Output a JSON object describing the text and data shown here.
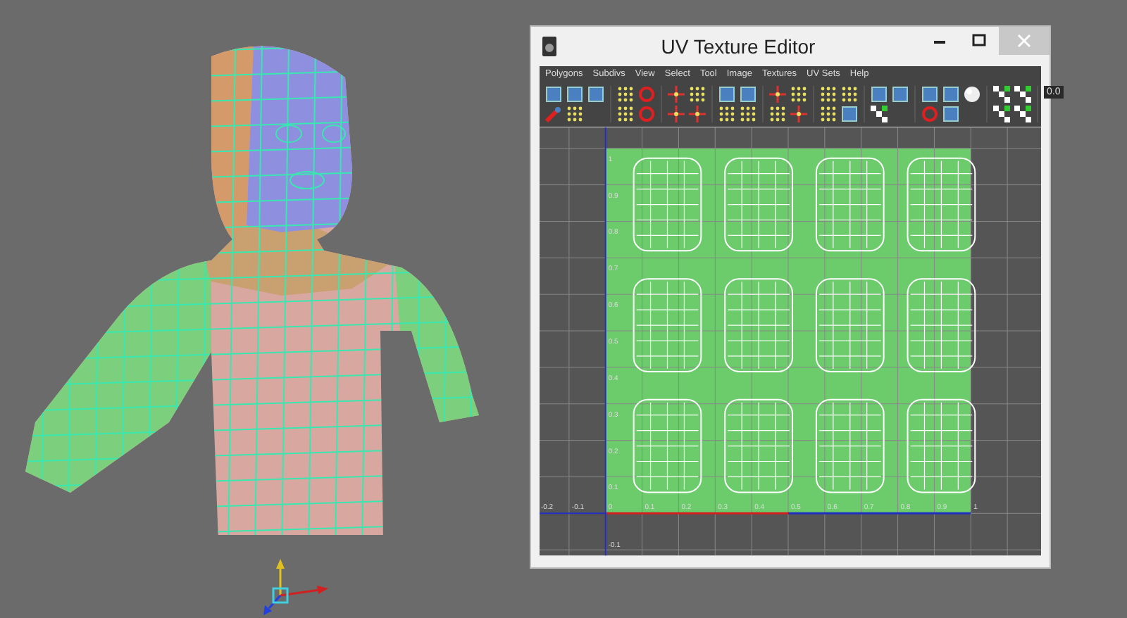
{
  "window": {
    "title": "UV Texture Editor"
  },
  "menu": [
    "Polygons",
    "Subdivs",
    "View",
    "Select",
    "Tool",
    "Image",
    "Textures",
    "UV Sets",
    "Help"
  ],
  "toolbar": {
    "field_value": "0.0"
  },
  "uv_grid": {
    "x_labels": [
      "-0.2",
      "-0.1",
      "0",
      "0.1",
      "0.2",
      "0.3",
      "0.4",
      "0.5",
      "0.6",
      "0.7",
      "0.8",
      "0.9",
      "1"
    ],
    "y_labels": [
      "1",
      "0.9",
      "0.8",
      "0.7",
      "0.6",
      "0.5",
      "0.4",
      "0.3",
      "0.2",
      "0.1",
      "-0.1"
    ]
  }
}
